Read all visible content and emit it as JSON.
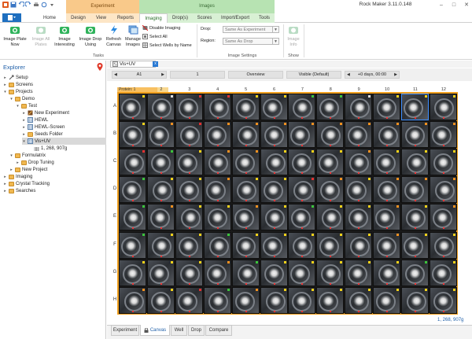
{
  "app": {
    "title": "Rock Maker 3.11.0.148"
  },
  "context": {
    "experiment": "Experiment",
    "images": "Images"
  },
  "tabs": {
    "home": "Home",
    "design": "Design",
    "view": "View",
    "reports": "Reports",
    "imaging": "Imaging",
    "drops": "Drop(s)",
    "scores": "Scores",
    "import_export": "Import/Export",
    "tools": "Tools"
  },
  "ribbon": {
    "image_plate_now": "Image Plate\nNow",
    "image_all_plates": "Image All\nPlates",
    "image_interesting": "Image\nInteresting",
    "image_drop_using": "Image Drop\nUsing",
    "refresh_canvas": "Refresh\nCanvas",
    "manage_images": "Manage\nImages",
    "tasks_label": "Tasks",
    "disable_imaging": "Disable Imaging",
    "select_all": "Select All",
    "select_wells_by_name": "Select Wells by Name",
    "drop_label": "Drop:",
    "drop_value": "Same As Experiment",
    "region_label": "Region:",
    "region_value": "Same As Drop",
    "image_settings_label": "Image Settings",
    "image_info": "Image\nInfo",
    "show_label": "Show"
  },
  "explorer": {
    "title": "Explorer",
    "items": [
      {
        "label": "Setup",
        "depth": 0,
        "twisty": "▸",
        "kind": "setup"
      },
      {
        "label": "Screens",
        "depth": 0,
        "twisty": "▸",
        "kind": "folder"
      },
      {
        "label": "Projects",
        "depth": 0,
        "twisty": "▾",
        "kind": "folder"
      },
      {
        "label": "Demo",
        "depth": 1,
        "twisty": "▾",
        "kind": "folder"
      },
      {
        "label": "Test",
        "depth": 2,
        "twisty": "▾",
        "kind": "folder"
      },
      {
        "label": "New Experiment",
        "depth": 3,
        "twisty": "▸",
        "kind": "experiment"
      },
      {
        "label": "HEWL",
        "depth": 3,
        "twisty": "▸",
        "kind": "plate"
      },
      {
        "label": "HEWL-Screen",
        "depth": 3,
        "twisty": "▸",
        "kind": "plate"
      },
      {
        "label": "Seeds Folder",
        "depth": 3,
        "twisty": "▸",
        "kind": "folder"
      },
      {
        "label": "Vis+UV",
        "depth": 3,
        "twisty": "▾",
        "kind": "plate",
        "selected": true
      },
      {
        "label": "1, 268, 907g",
        "depth": 4,
        "twisty": "",
        "kind": "barcode"
      },
      {
        "label": "Formulatrix",
        "depth": 1,
        "twisty": "▾",
        "kind": "folder"
      },
      {
        "label": "Drop Tuning",
        "depth": 2,
        "twisty": "▸",
        "kind": "folder"
      },
      {
        "label": "New Project",
        "depth": 1,
        "twisty": "▸",
        "kind": "folder"
      },
      {
        "label": "Imaging",
        "depth": 0,
        "twisty": "▸",
        "kind": "folder"
      },
      {
        "label": "Crystal Tracking",
        "depth": 0,
        "twisty": "▸",
        "kind": "folder"
      },
      {
        "label": "Searches",
        "depth": 0,
        "twisty": "▸",
        "kind": "folder"
      }
    ]
  },
  "document": {
    "tab_label": "Vis+UV",
    "tab_close": "x",
    "nav": {
      "well": "A1",
      "drop": "1",
      "view": "Overview",
      "imaging": "Visible (Default)",
      "time": "+0 days, 00:00"
    },
    "protein_label": "Protein: 1",
    "plate_info": "1, 268, 907g"
  },
  "plate": {
    "columns": [
      "1",
      "2",
      "3",
      "4",
      "5",
      "6",
      "7",
      "8",
      "9",
      "10",
      "11",
      "12"
    ],
    "rows": [
      "A",
      "B",
      "C",
      "D",
      "E",
      "F",
      "G",
      "H"
    ],
    "selected_well": "A11",
    "flag_colors": {
      "y": "#f2d21a",
      "g": "#3bc43b",
      "r": "#e23030",
      "o": "#f09020",
      "w": "#dddddd"
    },
    "flags": [
      [
        "y",
        "w",
        "r",
        "r",
        "y",
        "y",
        "g",
        "g",
        "w",
        "y",
        "y",
        "y"
      ],
      [
        "y",
        "o",
        "r",
        "o",
        "o",
        "o",
        "o",
        "o",
        "o",
        "o",
        "o",
        "o"
      ],
      [
        "r",
        "g",
        "y",
        "o",
        "o",
        "y",
        "y",
        "y",
        "o",
        "y",
        "y",
        "y"
      ],
      [
        "g",
        "y",
        "y",
        "o",
        "y",
        "y",
        "r",
        "o",
        "y",
        "o",
        "o",
        "o"
      ],
      [
        "g",
        "o",
        "y",
        "y",
        "o",
        "y",
        "g",
        "y",
        "y",
        "o",
        "y",
        "o"
      ],
      [
        "g",
        "y",
        "y",
        "g",
        "y",
        "y",
        "y",
        "y",
        "y",
        "o",
        "y",
        "y"
      ],
      [
        "y",
        "y",
        "y",
        "o",
        "g",
        "y",
        "y",
        "y",
        "y",
        "y",
        "g",
        "y"
      ],
      [
        "o",
        "y",
        "r",
        "g",
        "o",
        "y",
        "y",
        "y",
        "y",
        "y",
        "y",
        "y"
      ]
    ]
  },
  "bottom_tabs": {
    "experiment": "Experiment",
    "canvas": "Canvas",
    "well": "Well",
    "drop": "Drop",
    "compare": "Compare"
  }
}
